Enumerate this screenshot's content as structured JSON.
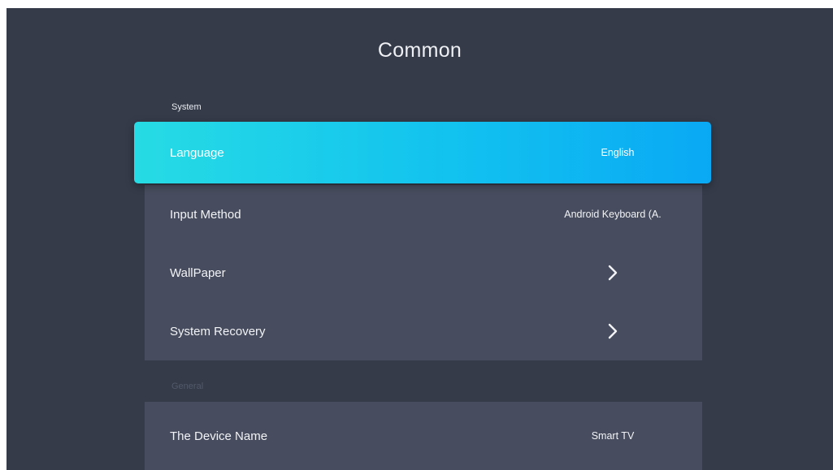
{
  "header": {
    "title": "Common"
  },
  "sections": [
    {
      "label": "System",
      "items": [
        {
          "label": "Language",
          "value": "English"
        },
        {
          "label": "Input Method",
          "value": "Android Keyboard (A."
        },
        {
          "label": "WallPaper",
          "icon": "chevron-right-icon"
        },
        {
          "label": "System Recovery",
          "icon": "chevron-right-icon"
        }
      ]
    },
    {
      "label": "General",
      "items": [
        {
          "label": "The Device Name",
          "value": "Smart TV"
        }
      ]
    }
  ],
  "focus": {
    "section": 0,
    "item": 0
  },
  "colors": {
    "background": "#353b49",
    "panel": "#474d5e",
    "focus_start": "#27dbe4",
    "focus_end": "#0aa9f4"
  }
}
